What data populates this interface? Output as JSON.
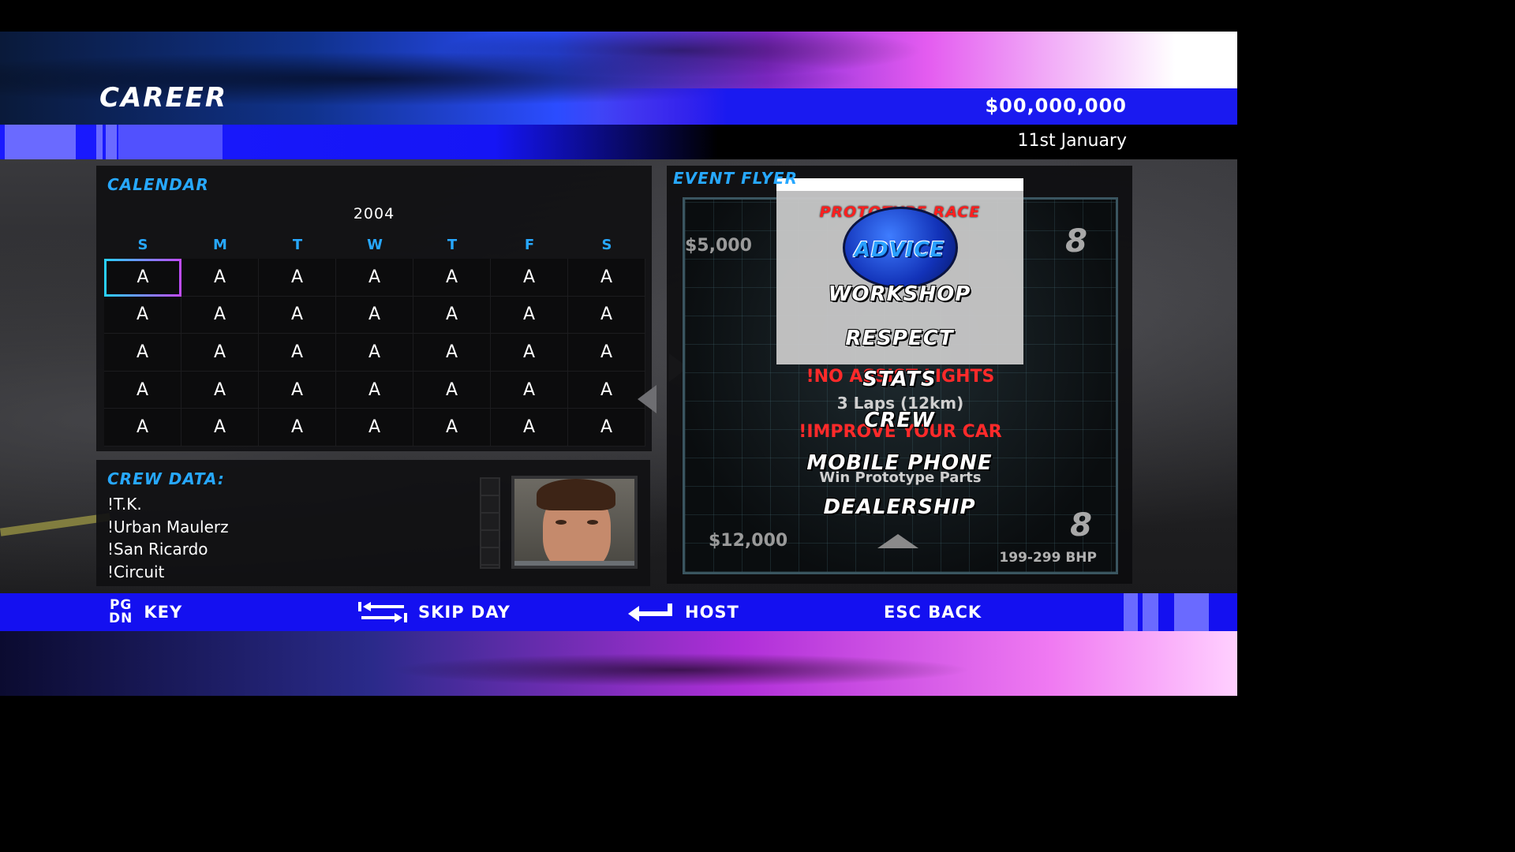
{
  "header": {
    "title": "CAREER",
    "money": "$00,000,000",
    "date": "11st January"
  },
  "calendar": {
    "heading": "CALENDAR",
    "year": "2004",
    "weekdays": [
      "S",
      "M",
      "T",
      "W",
      "T",
      "F",
      "S"
    ],
    "weeks": [
      [
        "A",
        "A",
        "A",
        "A",
        "A",
        "A",
        "A"
      ],
      [
        "A",
        "A",
        "A",
        "A",
        "A",
        "A",
        "A"
      ],
      [
        "A",
        "A",
        "A",
        "A",
        "A",
        "A",
        "A"
      ],
      [
        "A",
        "A",
        "A",
        "A",
        "A",
        "A",
        "A"
      ],
      [
        "A",
        "A",
        "A",
        "A",
        "A",
        "A",
        "A"
      ]
    ],
    "selected_day": "week 1, Sunday"
  },
  "crew": {
    "heading": "CREW DATA:",
    "lines": [
      "!T.K.",
      "!Urban Maulerz",
      "!San Ricardo",
      "!Circuit"
    ]
  },
  "flyer": {
    "heading": "EVENT FLYER",
    "race_label": "PROTOTYPE RACE",
    "price_top": "$5,000",
    "price_bottom": "$12,000",
    "rank_top": "8",
    "rank_bottom": "8",
    "note1": "!NO ASSIST LIGHTS",
    "laps": "3 Laps (12km)",
    "note2": "!IMPROVE YOUR CAR",
    "reward": "Win Prototype Parts",
    "power": "199-299 BHP"
  },
  "menu": {
    "items": [
      "ADVICE",
      "WORKSHOP",
      "RESPECT",
      "STATS",
      "CREW",
      "MOBILE PHONE",
      "DEALERSHIP"
    ],
    "active": "ADVICE"
  },
  "bottom_bar": {
    "key_line1": "PG",
    "key_line2": "DN",
    "key_label": "KEY",
    "skip_label": "SKIP DAY",
    "host_label": "HOST",
    "back_label": "ESC BACK"
  },
  "colors": {
    "accent_blue": "#27a8ff",
    "bar_blue": "#1410f0",
    "warning_red": "#ff2a2a"
  }
}
